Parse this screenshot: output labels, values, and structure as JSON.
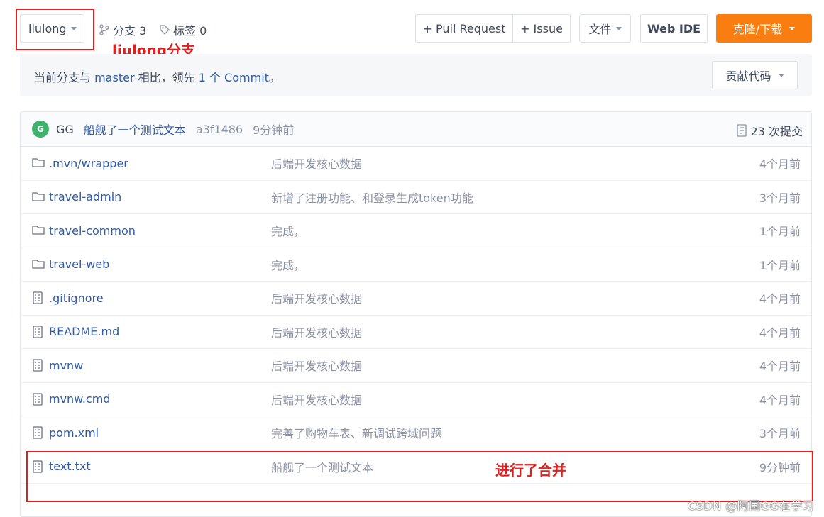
{
  "toolbar": {
    "branch": "liulong",
    "branches_label": "分支 3",
    "tags_label": "标签 0",
    "pull_request_label": "+ Pull Request",
    "issue_label": "+ Issue",
    "file_label": "文件",
    "web_ide_label": "Web IDE",
    "clone_label": "克隆/下载"
  },
  "annotations": {
    "branch_note": "liulong分支",
    "merge_note": "进行了合并"
  },
  "compare": {
    "prefix": "当前分支与 ",
    "branch": "master",
    "middle": " 相比，领先 ",
    "count": "1 个 Commit",
    "suffix": "。",
    "contribute_label": "贡献代码"
  },
  "latest_commit": {
    "avatar_letter": "G",
    "author": "GG",
    "message": "船舰了一个测试文本",
    "sha": "a3f1486",
    "time": "9分钟前",
    "total_commits": "23 次提交"
  },
  "files": [
    {
      "name": ".mvn/wrapper",
      "type": "folder",
      "commit": "后端开发核心数据",
      "time": "4个月前"
    },
    {
      "name": "travel-admin",
      "type": "folder",
      "commit": "新增了注册功能、和登录生成token功能",
      "time": "3个月前"
    },
    {
      "name": "travel-common",
      "type": "folder",
      "commit": "完成，",
      "time": "1个月前"
    },
    {
      "name": "travel-web",
      "type": "folder",
      "commit": "完成，",
      "time": "1个月前"
    },
    {
      "name": ".gitignore",
      "type": "file",
      "commit": "后端开发核心数据",
      "time": "4个月前"
    },
    {
      "name": "README.md",
      "type": "file",
      "commit": "后端开发核心数据",
      "time": "4个月前"
    },
    {
      "name": "mvnw",
      "type": "file",
      "commit": "后端开发核心数据",
      "time": "4个月前"
    },
    {
      "name": "mvnw.cmd",
      "type": "file",
      "commit": "后端开发核心数据",
      "time": "4个月前"
    },
    {
      "name": "pom.xml",
      "type": "file",
      "commit": "完善了购物车表、新调试跨域问题",
      "time": "3个月前"
    },
    {
      "name": "text.txt",
      "type": "file",
      "commit": "船舰了一个测试文本",
      "time": "9分钟前"
    }
  ],
  "watermark": "CSDN @阿国GG在学习",
  "colors": {
    "accent": "#fa7d0f",
    "link": "#2f5aa8",
    "annotation": "#e02020",
    "avatar": "#3db36b"
  }
}
